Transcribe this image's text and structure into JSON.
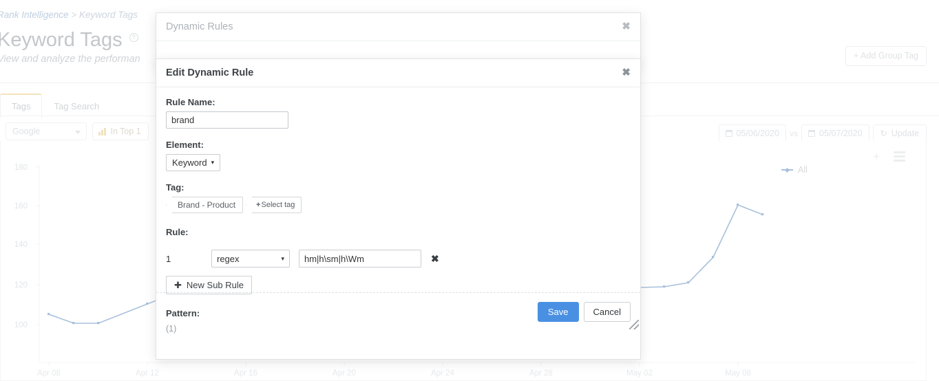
{
  "page": {
    "breadcrumb": {
      "root": "Rank Intelligence",
      "separator": ">",
      "current": "Keyword Tags"
    },
    "title": "Keyword Tags",
    "subtitle": "View and analyze the performan",
    "add_group_tag": "+ Add Group Tag",
    "tabs": [
      {
        "label": "Tags",
        "active": true
      },
      {
        "label": "Tag Search",
        "active": false
      }
    ],
    "toolbar": {
      "engine_select": "Google",
      "metric_chip": "In Top 1",
      "date_from": "05/06/2020",
      "vs": "vs",
      "date_to": "05/07/2020",
      "update_label": "Update",
      "refresh_icon": "↻"
    },
    "chart_actions": {
      "plus": "+",
      "menu": "menu-icon"
    }
  },
  "chart_data": {
    "type": "line",
    "title": "",
    "xlabel": "",
    "ylabel": "",
    "ylim": [
      80,
      190
    ],
    "yticks": [
      100,
      120,
      140,
      160,
      180
    ],
    "xticks": [
      "Apr 08",
      "Apr 12",
      "Apr 16",
      "Apr 20",
      "Apr 24",
      "Apr 28",
      "May 02",
      "May 06"
    ],
    "grid": false,
    "legend": {
      "position": "top-right",
      "entries": [
        "All"
      ]
    },
    "series": [
      {
        "name": "All",
        "color": "#a8c0dc",
        "x": [
          "Apr 08",
          "Apr 09",
          "Apr 10",
          "Apr 11",
          "Apr 30",
          "May 01",
          "May 02",
          "May 04",
          "May 06",
          "May 07"
        ],
        "values": [
          106,
          101,
          101,
          106,
          111,
          119,
          117,
          122,
          128,
          135,
          160,
          155
        ]
      }
    ]
  },
  "modal_back": {
    "title": "Dynamic Rules",
    "close": "✖"
  },
  "modal": {
    "title": "Edit Dynamic Rule",
    "close": "✖",
    "rule_name_label": "Rule Name:",
    "rule_name_value": "brand",
    "element_label": "Element:",
    "element_value": "Keyword",
    "element_caret": "▾",
    "tag_label": "Tag:",
    "tags": [
      {
        "label": "Brand - Product",
        "type": "selected"
      },
      {
        "label": "Select tag",
        "type": "add",
        "plus": "+"
      }
    ],
    "rule_label": "Rule:",
    "rules": [
      {
        "index": "1",
        "operator": "regex",
        "value": "hm|h\\sm|h\\Wm",
        "delete": "✖"
      }
    ],
    "operator_caret": "▾",
    "new_sub_rule": "New Sub Rule",
    "new_sub_rule_plus": "✚",
    "pattern_label": "Pattern:",
    "pattern_value": "(1)",
    "save_label": "Save",
    "cancel_label": "Cancel"
  },
  "colors": {
    "accent_blue": "#4a90e2",
    "chart_line": "#a8c0dc",
    "tab_active_top": "#f3e3bb"
  }
}
